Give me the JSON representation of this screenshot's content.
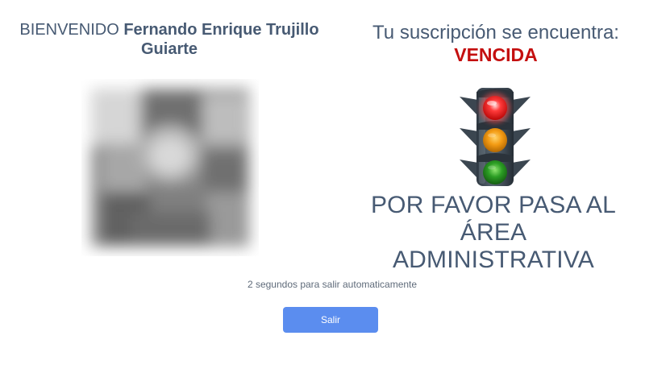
{
  "welcome": {
    "prefix": "BIENVENIDO",
    "name_line1": "Fernando Enrique Trujillo",
    "name_line2": "Guiarte"
  },
  "subscription": {
    "label": "Tu suscripción se encuentra:",
    "status": "VENCIDA",
    "status_color": "#c40f0f"
  },
  "traffic_light": {
    "icon": "traffic-light-icon",
    "active": "red"
  },
  "instruction": {
    "line1": "POR FAVOR PASA AL ÁREA",
    "line2": "ADMINISTRATIVA"
  },
  "countdown": {
    "text": "2 segundos para salir automaticamente"
  },
  "exit_button": {
    "label": "Salir",
    "color": "#5b8def"
  },
  "theme": {
    "text_color": "#475a73"
  }
}
